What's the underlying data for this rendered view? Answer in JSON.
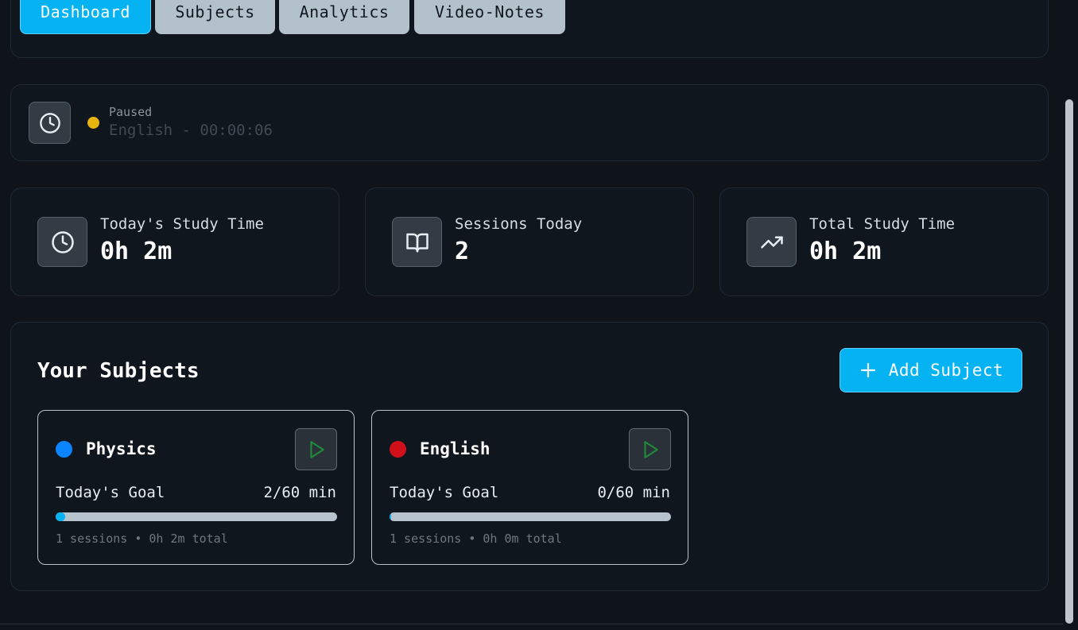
{
  "nav": {
    "tabs": [
      {
        "label": "Dashboard",
        "active": true
      },
      {
        "label": "Subjects",
        "active": false
      },
      {
        "label": "Analytics",
        "active": false
      },
      {
        "label": "Video-Notes",
        "active": false
      }
    ]
  },
  "timer": {
    "icon": "clock-icon",
    "status_label": "Paused",
    "status_color": "#e8b30f",
    "current": "English - 00:00:06"
  },
  "stats": [
    {
      "icon": "clock-icon",
      "label": "Today's Study Time",
      "value": "0h 2m"
    },
    {
      "icon": "book-open-icon",
      "label": "Sessions Today",
      "value": "2"
    },
    {
      "icon": "trending-up-icon",
      "label": "Total Study Time",
      "value": "0h 2m"
    }
  ],
  "subjects_section": {
    "title": "Your Subjects",
    "add_button_label": "Add Subject",
    "add_icon": "plus-icon"
  },
  "subjects": [
    {
      "name": "Physics",
      "color": "#0a84ff",
      "goal_label": "Today's Goal",
      "goal_value": "2/60 min",
      "progress": 0.0333,
      "meta": "1 sessions • 0h 2m total",
      "play_icon": "play-icon"
    },
    {
      "name": "English",
      "color": "#d0101b",
      "goal_label": "Today's Goal",
      "goal_value": "0/60 min",
      "progress": 0.0,
      "meta": "1 sessions • 0h 0m total",
      "play_icon": "play-icon"
    }
  ],
  "colors": {
    "accent": "#05b3f2",
    "background": "#0f141b",
    "play_green": "#1f8a3a"
  }
}
